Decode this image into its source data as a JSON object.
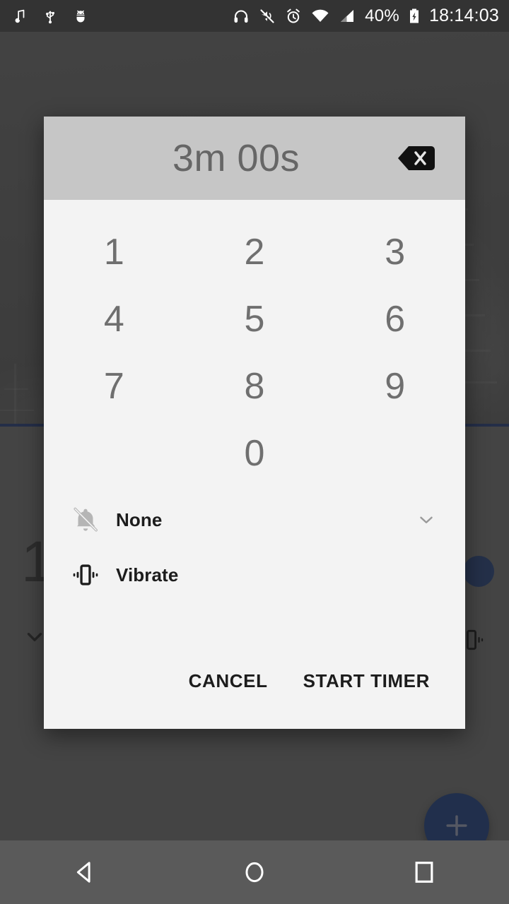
{
  "status_bar": {
    "left_icons": [
      "music-note-icon",
      "usb-icon",
      "android-bug-icon"
    ],
    "right_icons": [
      "headphones-icon",
      "mute-icon",
      "alarm-icon",
      "wifi-icon",
      "signal-icon"
    ],
    "battery_percent": "40%",
    "battery_icon": "battery-charging-icon",
    "clock": "18:14:03"
  },
  "dialog": {
    "timer_value": "3m 00s",
    "backspace_icon": "backspace-icon",
    "keypad": [
      [
        "1",
        "2",
        "3"
      ],
      [
        "4",
        "5",
        "6"
      ],
      [
        "7",
        "8",
        "9"
      ],
      [
        "",
        "0",
        ""
      ]
    ],
    "options": [
      {
        "label": "None",
        "icon": "bell-off-icon",
        "chevron": "chevron-down-icon",
        "enabled": false
      },
      {
        "label": "Vibrate",
        "icon": "vibrate-icon",
        "chevron": "",
        "enabled": true
      }
    ],
    "cancel_label": "CANCEL",
    "start_label": "START TIMER"
  },
  "background": {
    "alarm_time": "1",
    "expand_icon": "chevron-down-icon",
    "vibrate_icon": "vibrate-icon",
    "toggle_icon": "alarm-toggle",
    "fab_icon": "plus-icon",
    "accent_color": "#2a3f72",
    "fab_color": "#24407a"
  },
  "nav_bar": {
    "back_icon": "back-triangle-icon",
    "home_icon": "home-circle-icon",
    "recents_icon": "recents-square-icon"
  }
}
